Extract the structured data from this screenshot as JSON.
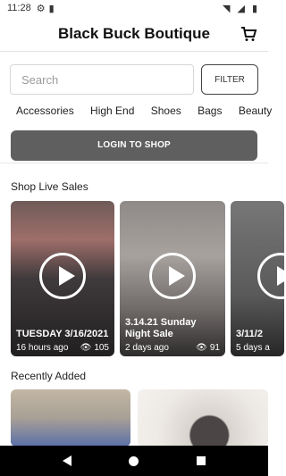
{
  "status_bar": {
    "time": "11:28"
  },
  "header": {
    "title": "Black Buck Boutique",
    "cart_icon": "cart-icon"
  },
  "search": {
    "placeholder": "Search",
    "filter_label": "FILTER"
  },
  "categories": [
    "Accessories",
    "High End",
    "Shoes",
    "Bags",
    "Beauty"
  ],
  "login": {
    "label": "LOGIN TO SHOP"
  },
  "live_sales": {
    "title": "Shop Live Sales",
    "cards": [
      {
        "title": "TUESDAY 3/16/2021",
        "time": "16 hours ago",
        "views": "105"
      },
      {
        "title": "3.14.21 Sunday Night Sale",
        "time": "2 days ago",
        "views": "91"
      },
      {
        "title": "3/11/2",
        "time": "5 days a",
        "views": ""
      }
    ]
  },
  "recently_added": {
    "title": "Recently Added"
  },
  "colors": {
    "login_bg": "#5f5f5f",
    "nav_bg": "#000000"
  }
}
